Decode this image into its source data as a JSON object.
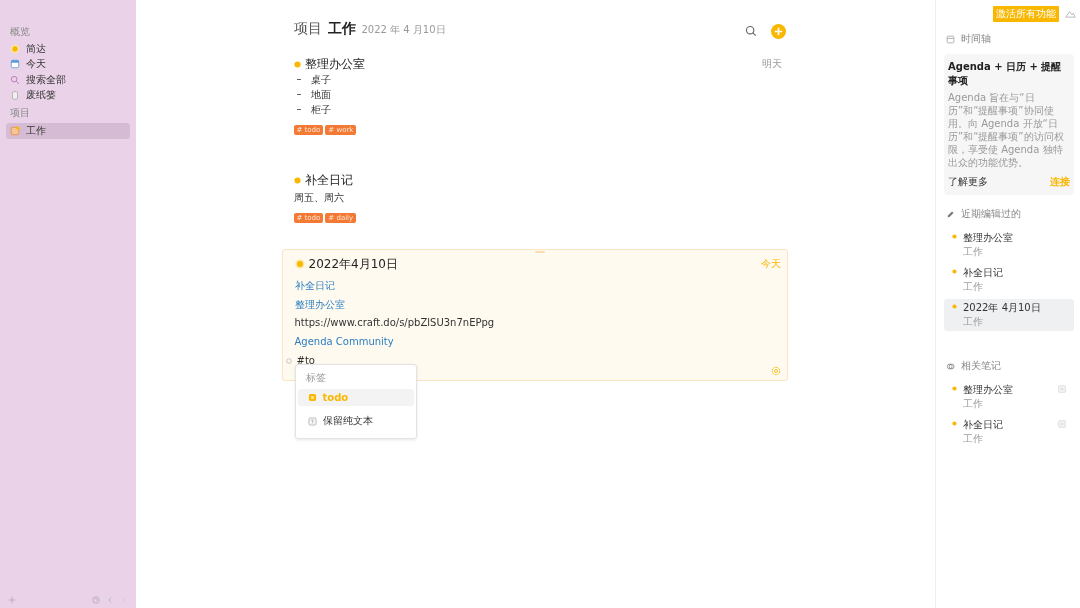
{
  "sidebar": {
    "sections": [
      {
        "heading": "概览",
        "items": [
          {
            "label": "简达",
            "kind": "overview",
            "selected": false
          },
          {
            "label": "今天",
            "kind": "today",
            "selected": false
          },
          {
            "label": "搜索全部",
            "kind": "search",
            "selected": false
          },
          {
            "label": "废纸篓",
            "kind": "trash",
            "selected": false
          }
        ]
      },
      {
        "heading": "项目",
        "items": [
          {
            "label": "工作",
            "kind": "project",
            "selected": true
          }
        ]
      }
    ]
  },
  "header": {
    "prefix": "项目",
    "title": "工作",
    "date": "2022 年 4 月10日"
  },
  "notes": [
    {
      "title": "整理办公室",
      "due": "明天",
      "bullets": [
        "桌子",
        "地面",
        "柜子"
      ],
      "tags": [
        "# todo",
        "# work"
      ]
    },
    {
      "title": "补全日记",
      "body": "周五、周六",
      "tags": [
        "# todo",
        "# daily"
      ]
    }
  ],
  "active_note": {
    "title": "2022年4月10日",
    "due": "今天",
    "lines": [
      {
        "kind": "link",
        "text": "补全日记"
      },
      {
        "kind": "link",
        "text": "整理办公室"
      },
      {
        "kind": "text",
        "text": "https://www.craft.do/s/pbZlSU3n7nEPpg"
      },
      {
        "kind": "link",
        "text": "Agenda Community"
      }
    ],
    "input": "#to",
    "popup": {
      "heading": "标签",
      "items": [
        {
          "label": "todo",
          "kind": "tag",
          "selected": true
        },
        {
          "label": "保留纯文本",
          "kind": "plain",
          "selected": false
        }
      ]
    }
  },
  "right_panel": {
    "badge": "激活所有功能",
    "timeline": {
      "title": "时间轴",
      "card_title": "Agenda + 日历 + 提醒事项",
      "card_body": "Agenda 旨在与“日历”和“提醒事项”协同使用。向 Agenda 开放“日历”和“提醒事项”的访问权限，享受使 Agenda 独特出众的功能优势。",
      "learn_more": "了解更多",
      "connect": "连接"
    },
    "recent": {
      "title": "近期编辑过的",
      "items": [
        {
          "title": "整理办公室",
          "project": "工作",
          "selected": false
        },
        {
          "title": "补全日记",
          "project": "工作",
          "selected": false
        },
        {
          "title": "2022年 4月10日",
          "project": "工作",
          "selected": true
        }
      ]
    },
    "related": {
      "title": "相关笔记",
      "items": [
        {
          "title": "整理办公室",
          "project": "工作"
        },
        {
          "title": "补全日记",
          "project": "工作"
        }
      ]
    }
  }
}
